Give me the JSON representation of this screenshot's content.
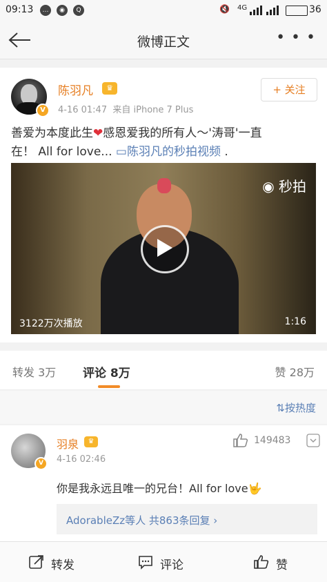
{
  "status": {
    "time": "09:13",
    "network": "4G",
    "battery": "36"
  },
  "header": {
    "title": "微博正文"
  },
  "post": {
    "username": "陈羽凡",
    "time": "4-16 01:47",
    "source": "来自 iPhone 7 Plus",
    "follow_label": "+ 关注",
    "text_line1": "善爱为本度此生",
    "text_line1b": "感恩爱我的所有人～'涛哥'一直",
    "text_line2a": "在！ All for love... ",
    "link_text": "陈羽凡的秒拍视频",
    "text_line2b": " .",
    "video": {
      "brand": "秒拍",
      "play_count": "3122万次播放",
      "duration": "1:16"
    }
  },
  "tabs": {
    "repost": "转发 3万",
    "comment": "评论 8万",
    "like": "赞 28万"
  },
  "sort": {
    "label": "按热度"
  },
  "comment": {
    "username": "羽泉",
    "time": "4-16 02:46",
    "like_count": "149483",
    "text": "你是我永远且唯一的兄台！All for love",
    "reply_summary": "AdorableZz等人  共863条回复 ›"
  },
  "bottom": {
    "repost": "转发",
    "comment": "评论",
    "like": "赞"
  },
  "colors": {
    "accent": "#f28c28",
    "username": "#e67e22",
    "link": "#5a7fb5"
  }
}
